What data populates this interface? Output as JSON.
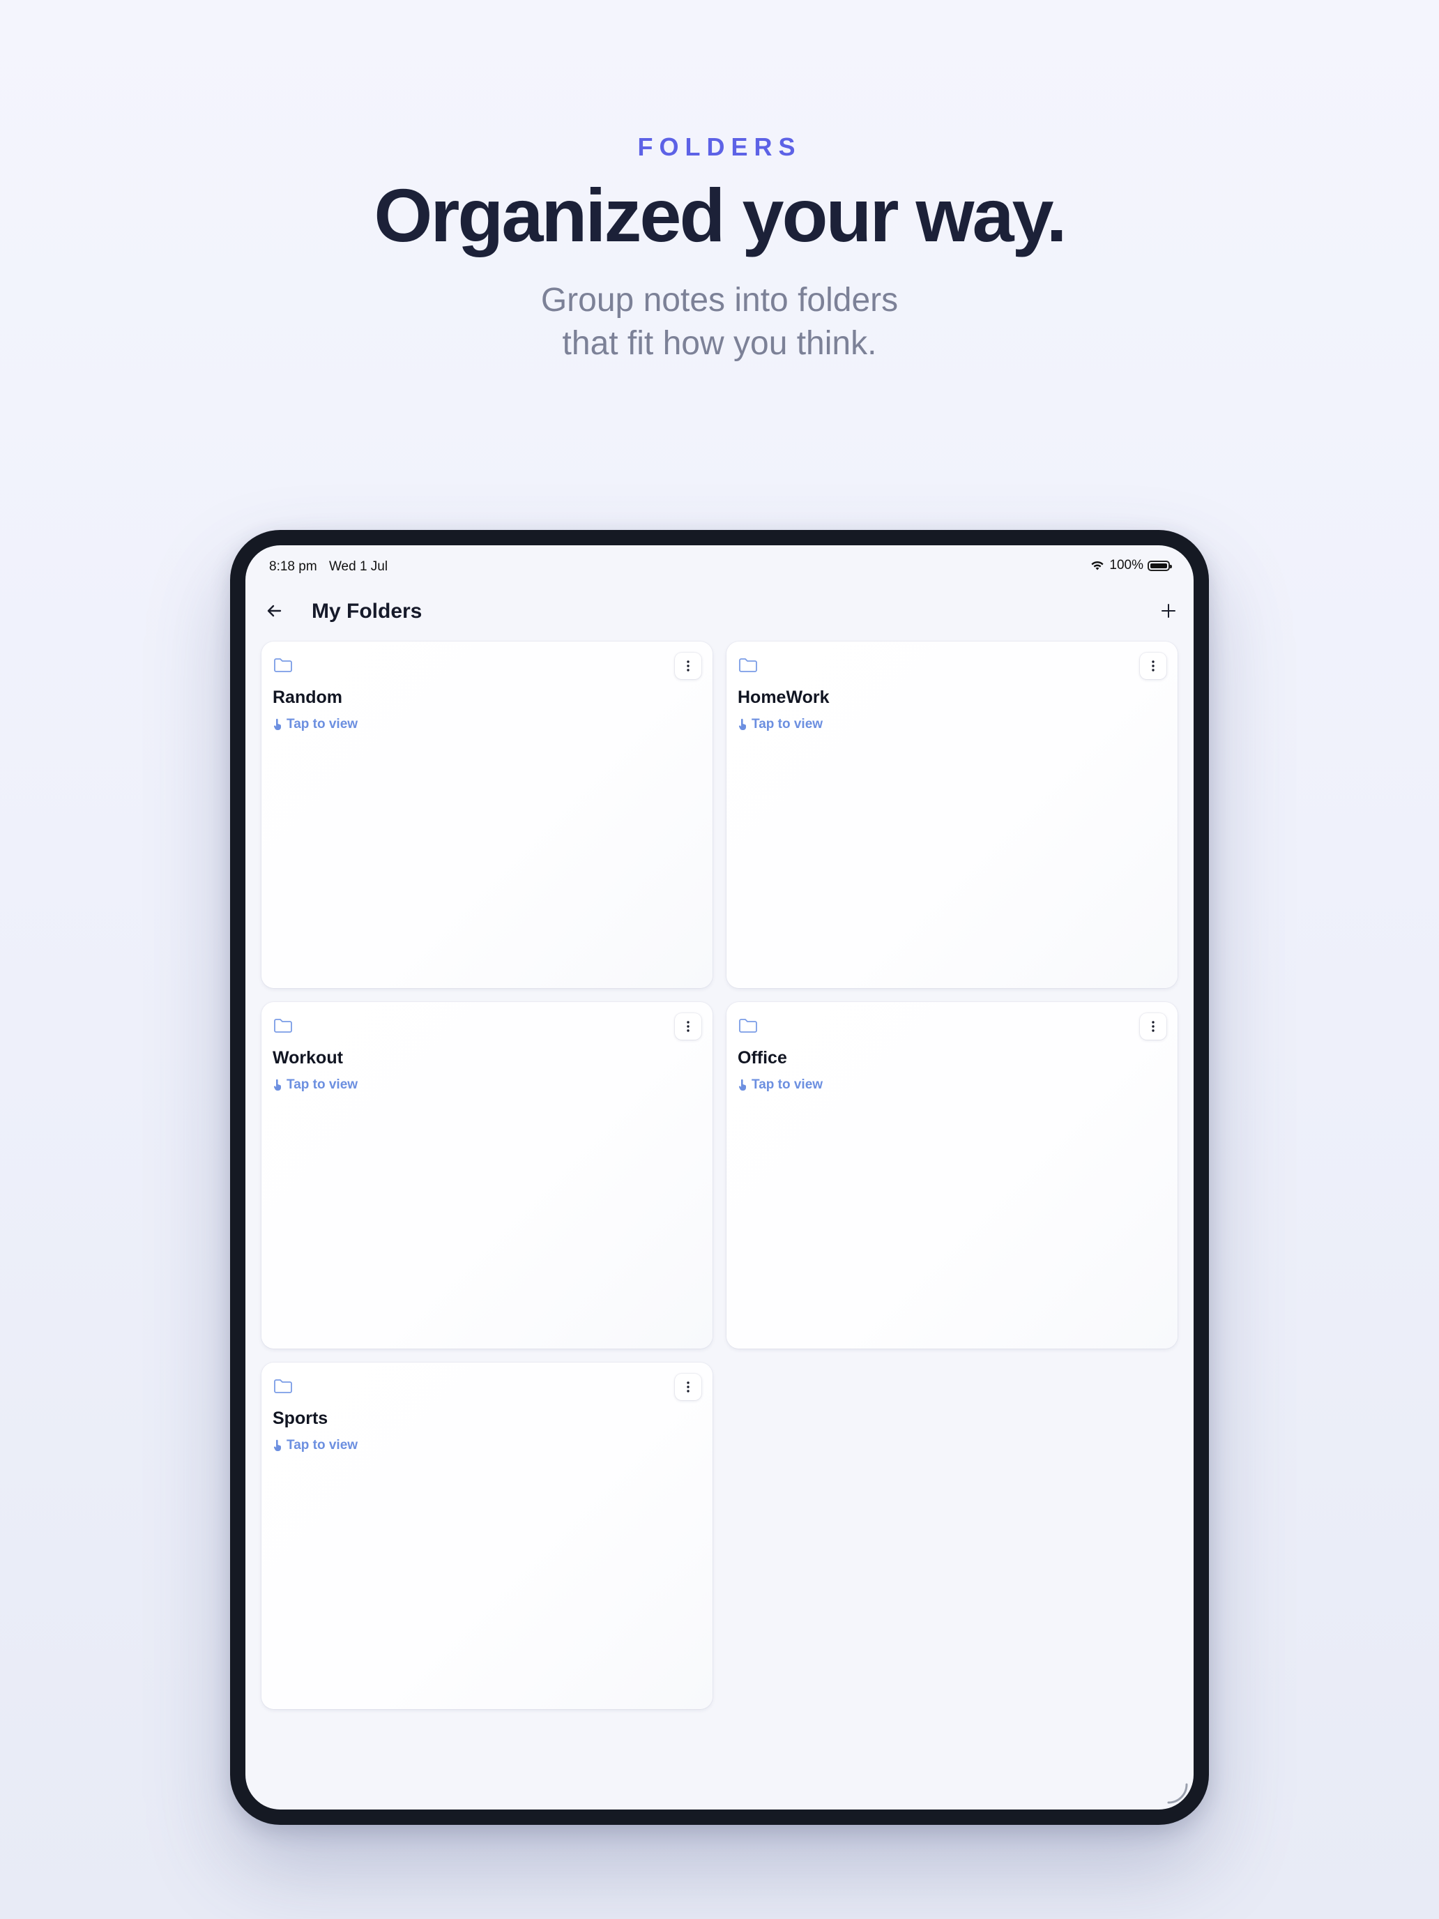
{
  "marketing": {
    "eyebrow": "FOLDERS",
    "headline": "Organized your way.",
    "subhead_lines": [
      "Group notes into folders",
      "that fit how you think."
    ]
  },
  "status_bar": {
    "time": "8:18 pm",
    "date": "Wed 1 Jul",
    "battery": "100%",
    "icons": [
      "wifi-icon",
      "battery-icon"
    ]
  },
  "nav": {
    "title": "My Folders",
    "back_icon": "arrow-left-icon",
    "add_icon": "plus-icon"
  },
  "folders": [
    {
      "name": "Random",
      "hint": "Tap to view"
    },
    {
      "name": "HomeWork",
      "hint": "Tap to view"
    },
    {
      "name": "Workout",
      "hint": "Tap to view"
    },
    {
      "name": "Office",
      "hint": "Tap to view"
    },
    {
      "name": "Sports",
      "hint": "Tap to view"
    }
  ],
  "colors": {
    "accent": "#5d62e6",
    "headline": "#1c2138",
    "subhead": "#7c8197",
    "hint": "#6c8fe0",
    "folder_icon": "#7a9ce6",
    "device_frame": "#151923"
  }
}
